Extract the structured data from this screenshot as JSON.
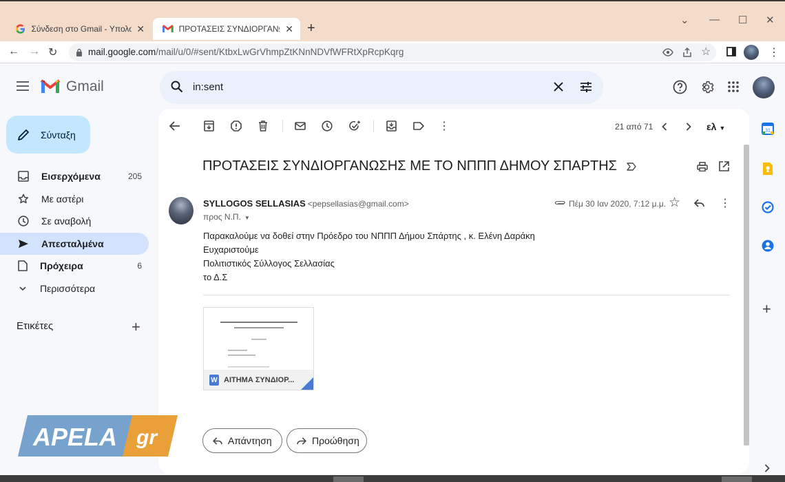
{
  "browser": {
    "tabs": [
      {
        "label": "Σύνδεση στο Gmail - Υπολογιστ",
        "icon": "google-g-icon",
        "active": false
      },
      {
        "label": "ΠΡΟΤΑΣΕΙΣ ΣΥΝΔΙΟΡΓΑΝΩΣΗΣ Μ",
        "icon": "gmail-icon",
        "active": true
      }
    ],
    "url_host": "mail.google.com",
    "url_path": "/mail/u/0/#sent/KtbxLwGrVhmpZtKNnNDVfWFRtXpRcpKqrg"
  },
  "gmail": {
    "logo_text": "Gmail",
    "search_value": "in:sent",
    "compose_label": "Σύνταξη",
    "nav": [
      {
        "label": "Εισερχόμενα",
        "count": "205",
        "icon": "inbox-icon",
        "bold": true,
        "active": false
      },
      {
        "label": "Με αστέρι",
        "count": "",
        "icon": "star-icon",
        "bold": false,
        "active": false
      },
      {
        "label": "Σε αναβολή",
        "count": "",
        "icon": "clock-icon",
        "bold": false,
        "active": false
      },
      {
        "label": "Απεσταλμένα",
        "count": "",
        "icon": "send-icon",
        "bold": true,
        "active": true
      },
      {
        "label": "Πρόχειρα",
        "count": "6",
        "icon": "draft-icon",
        "bold": true,
        "active": false
      },
      {
        "label": "Περισσότερα",
        "count": "",
        "icon": "chevron-down-icon",
        "bold": false,
        "active": false
      }
    ],
    "labels_title": "Ετικέτες"
  },
  "email": {
    "pager": "21 από 71",
    "lang": "ελ",
    "subject": "ΠΡΟΤΑΣΕΙΣ ΣΥΝΔΙΟΡΓΑΝΩΣΗΣ ΜΕ ΤΟ ΝΠΠΠ ΔΗΜΟΥ ΣΠΑΡΤΗΣ",
    "sender_name": "SYLLOGOS SELLASIAS",
    "sender_email": "<pepsellasias@gmail.com>",
    "to": "προς Ν.Π.",
    "date": "Πέμ 30 Ιαν 2020, 7:12 μ.μ.",
    "body": [
      "Παρακαλούμε να δοθεί στην Πρόεδρο του ΝΠΠΠ Δήμου Σπάρτης , κ. Ελένη Δαράκη",
      "Ευχαριστούμε",
      "Πολιτιστικός Σύλλογος Σελλασίας",
      "το Δ.Σ"
    ],
    "attachment_name": "ΑΙΤΗΜΑ ΣΥΝΔΙΟΡ...",
    "attachment_icon_letter": "W",
    "reply_label": "Απάντηση",
    "forward_label": "Προώθηση"
  },
  "watermark": {
    "main": "APELA",
    "suffix": "gr"
  },
  "colors": {
    "titlebar": "#f4dccb",
    "compose": "#c2e7ff",
    "active_nav": "#d3e3fd",
    "search_bg": "#eaf1fb",
    "watermark_blue": "#6a9ac9",
    "watermark_orange": "#f0a030"
  }
}
